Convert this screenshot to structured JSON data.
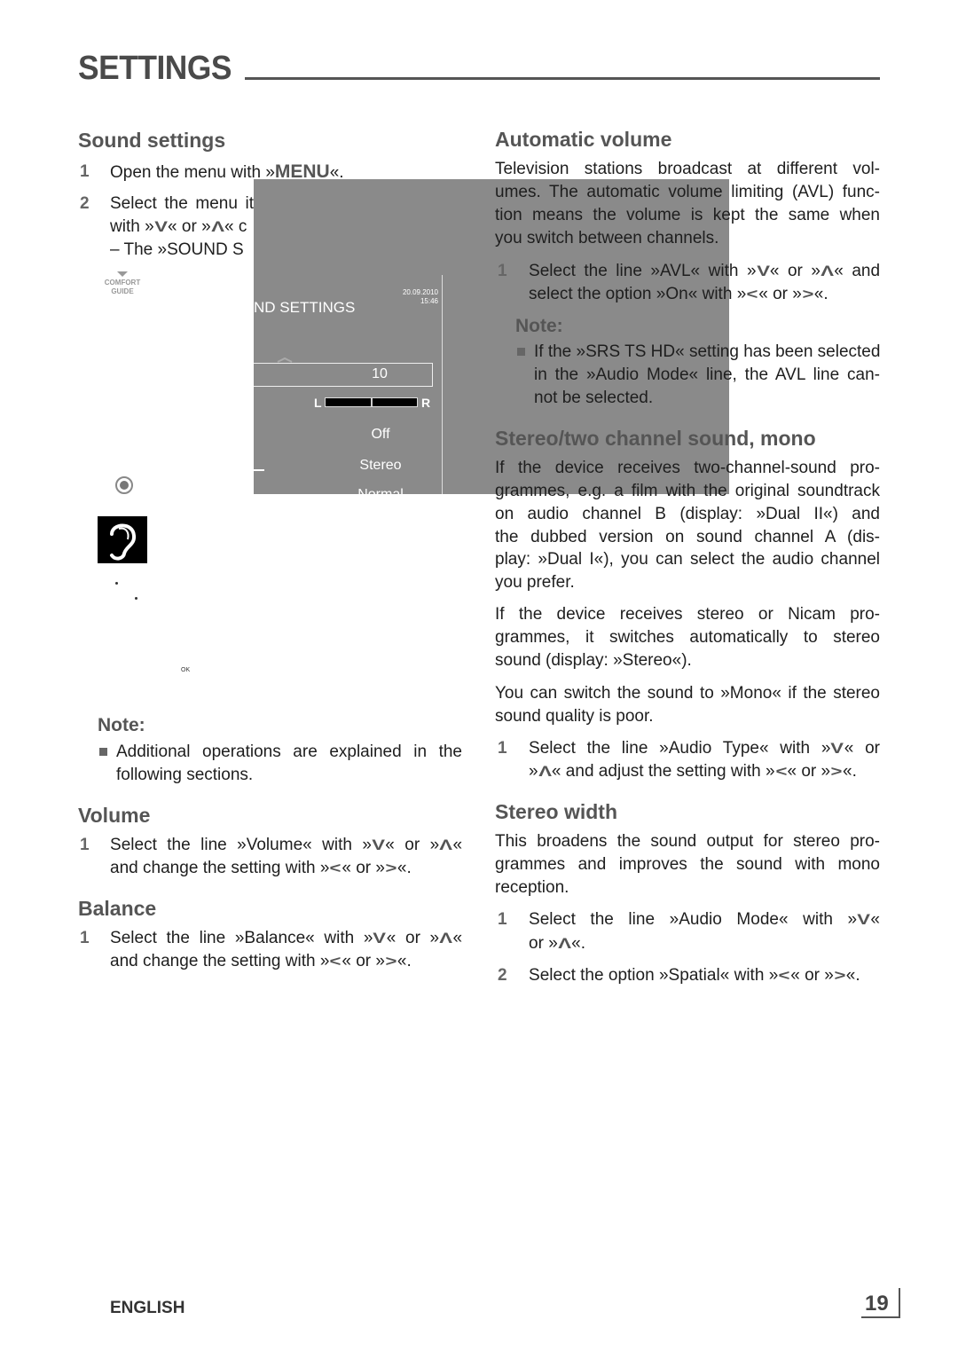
{
  "header": {
    "title": "SETTINGS"
  },
  "left": {
    "heading": "Sound settings",
    "step1": {
      "num": "1",
      "text": "Open the menu with »MENU«."
    },
    "step2": {
      "num": "2",
      "lines": [
        "Select the menu it",
        "with »∨« or »∧« c",
        "– The »SOUND S"
      ]
    },
    "comfort_guide": [
      "COMFORT",
      "GUIDE"
    ],
    "ok_label": "OK",
    "note": {
      "title": "Note:",
      "lines": [
        "Additional operations are explained in the",
        "following sections."
      ]
    },
    "volume": {
      "heading": "Volume",
      "num": "1",
      "lines": [
        "Select the line »Volume« with »∨« or »∧«",
        "and change the setting with »‹« or »›«."
      ]
    },
    "balance": {
      "heading": "Balance",
      "num": "1",
      "lines": [
        "Select the line »Balance« with »∨« or »∧«",
        "and change the setting with »‹« or »›«."
      ]
    }
  },
  "menu": {
    "title": "ND SETTINGS",
    "date": "20.09.2010",
    "time": "15:46",
    "volume_value": "10",
    "balance_left": "L",
    "balance_right": "R",
    "balance_level": 0.5,
    "values": [
      "Off",
      "Stereo",
      "Normal"
    ]
  },
  "right": {
    "auto_volume": {
      "heading": "Automatic volume",
      "para": [
        "Television stations broadcast at different vol-",
        "umes. The automatic volume limiting (AVL) func-",
        "tion means the volume is kept the same when",
        "you switch between channels."
      ],
      "num": "1",
      "step": [
        "Select the line »AVL« with »∨« or »∧« and",
        "select the option »On« with »‹« or »›«."
      ],
      "note_title": "Note:",
      "note": [
        "If the »SRS TS HD« setting has been selected",
        "in the »Audio Mode« line, the AVL line can-",
        "not be selected."
      ]
    },
    "stereo": {
      "heading": "Stereo/two channel sound, mono",
      "para1": [
        "If the device receives two-channel-sound pro-",
        "grammes, e.g. a film with the original soundtrack",
        "on audio channel B (display: »Dual II«) and",
        "the dubbed version on sound channel A (dis-",
        "play: »Dual I«), you can select the audio channel",
        "you prefer."
      ],
      "para2": [
        "If the device receives stereo or Nicam pro-",
        "grammes, it switches automatically to stereo",
        "sound (display: »Stereo«)."
      ],
      "para3": [
        "You can switch the sound to »Mono« if the stereo",
        "sound quality is poor."
      ],
      "num": "1",
      "step": [
        "Select the line »Audio Type« with »∨« or",
        "»∧« and adjust the setting with »‹« or »›«."
      ]
    },
    "width": {
      "heading": "Stereo width",
      "para": [
        "This broadens the sound output for stereo pro-",
        "grammes and improves the sound with mono",
        "reception."
      ],
      "num1": "1",
      "step1": [
        "Select the line »Audio Mode« with »∨«",
        "or »∧«."
      ],
      "num2": "2",
      "step2": [
        "Select the option »Spatial« with »‹« or »›«."
      ]
    }
  },
  "footer": {
    "language": "ENGLISH",
    "page": "19"
  }
}
